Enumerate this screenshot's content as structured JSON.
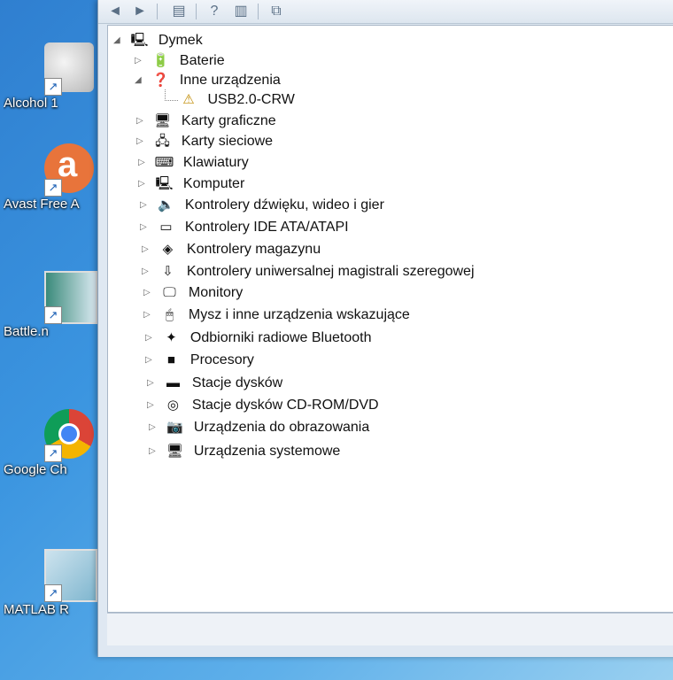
{
  "desktop": {
    "icons": [
      {
        "label": "Alcohol 1",
        "icon": "alcohol-icon"
      },
      {
        "label": "Avast Free A",
        "icon": "avast-icon"
      },
      {
        "label": "Battle.n",
        "icon": "battlenet-icon"
      },
      {
        "label": "Google Ch",
        "icon": "chrome-icon"
      },
      {
        "label": "MATLAB R",
        "icon": "matlab-icon"
      }
    ]
  },
  "toolbar": {
    "back": "◄",
    "forward": "►",
    "properties": "▤",
    "help": "?",
    "view": "▥",
    "scan": "⧉"
  },
  "tree": {
    "root": {
      "label": "Dymek",
      "icon": "computer-icon",
      "expander": "◢"
    },
    "items": [
      {
        "label": "Baterie",
        "icon": "battery-icon",
        "glyph": "🔋",
        "expander": "▷"
      },
      {
        "label": "Inne urządzenia",
        "icon": "unknown-device-icon",
        "glyph": "❓",
        "expander": "◢"
      },
      {
        "label": "USB2.0-CRW",
        "icon": "warning-device-icon",
        "glyph": "⚠",
        "expander": ""
      },
      {
        "label": "Karty graficzne",
        "icon": "display-adapter-icon",
        "glyph": "🖥",
        "expander": "▷"
      },
      {
        "label": "Karty sieciowe",
        "icon": "network-adapter-icon",
        "glyph": "🖧",
        "expander": "▷"
      },
      {
        "label": "Klawiatury",
        "icon": "keyboard-icon",
        "glyph": "⌨",
        "expander": "▷"
      },
      {
        "label": "Komputer",
        "icon": "computer-icon",
        "glyph": "🖳",
        "expander": "▷"
      },
      {
        "label": "Kontrolery dźwięku, wideo i gier",
        "icon": "sound-icon",
        "glyph": "🔈",
        "expander": "▷"
      },
      {
        "label": "Kontrolery IDE ATA/ATAPI",
        "icon": "ide-controller-icon",
        "glyph": "▭",
        "expander": "▷"
      },
      {
        "label": "Kontrolery magazynu",
        "icon": "storage-controller-icon",
        "glyph": "◈",
        "expander": "▷"
      },
      {
        "label": "Kontrolery uniwersalnej magistrali szeregowej",
        "icon": "usb-icon",
        "glyph": "⇩",
        "expander": "▷"
      },
      {
        "label": "Monitory",
        "icon": "monitor-icon",
        "glyph": "🖵",
        "expander": "▷"
      },
      {
        "label": "Mysz i inne urządzenia wskazujące",
        "icon": "mouse-icon",
        "glyph": "🖱",
        "expander": "▷"
      },
      {
        "label": "Odbiorniki radiowe Bluetooth",
        "icon": "bluetooth-icon",
        "glyph": "✦",
        "expander": "▷"
      },
      {
        "label": "Procesory",
        "icon": "processor-icon",
        "glyph": "■",
        "expander": "▷"
      },
      {
        "label": "Stacje dysków",
        "icon": "disk-drive-icon",
        "glyph": "▬",
        "expander": "▷"
      },
      {
        "label": "Stacje dysków CD-ROM/DVD",
        "icon": "cdrom-icon",
        "glyph": "◎",
        "expander": "▷"
      },
      {
        "label": "Urządzenia do obrazowania",
        "icon": "camera-icon",
        "glyph": "📷",
        "expander": "▷"
      },
      {
        "label": "Urządzenia systemowe",
        "icon": "system-device-icon",
        "glyph": "🖥",
        "expander": "▷"
      }
    ]
  }
}
